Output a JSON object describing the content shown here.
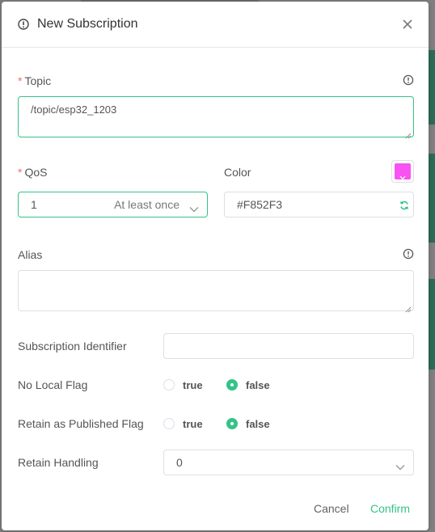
{
  "colors": {
    "accent": "#34c388",
    "required": "#f56c6c",
    "swatch": "#F852F3"
  },
  "dialog": {
    "title": "New Subscription",
    "header_icon": "info-circle-icon",
    "close_icon": "close-icon"
  },
  "topic": {
    "required_mark": "*",
    "label": "Topic",
    "value": "/topic/esp32_1203",
    "info_icon": "info-circle-icon"
  },
  "qos": {
    "required_mark": "*",
    "label": "QoS",
    "value": "1",
    "description": "At least once"
  },
  "color": {
    "label": "Color",
    "value": "#F852F3",
    "refresh_icon": "refresh-icon"
  },
  "alias": {
    "label": "Alias",
    "value": "",
    "info_icon": "info-circle-icon"
  },
  "subscription_identifier": {
    "label": "Subscription Identifier",
    "value": ""
  },
  "no_local_flag": {
    "label": "No Local Flag",
    "options": [
      "true",
      "false"
    ],
    "selected": "false"
  },
  "retain_as_published_flag": {
    "label": "Retain as Published Flag",
    "options": [
      "true",
      "false"
    ],
    "selected": "false"
  },
  "retain_handling": {
    "label": "Retain Handling",
    "value": "0"
  },
  "footer": {
    "cancel_label": "Cancel",
    "confirm_label": "Confirm"
  }
}
